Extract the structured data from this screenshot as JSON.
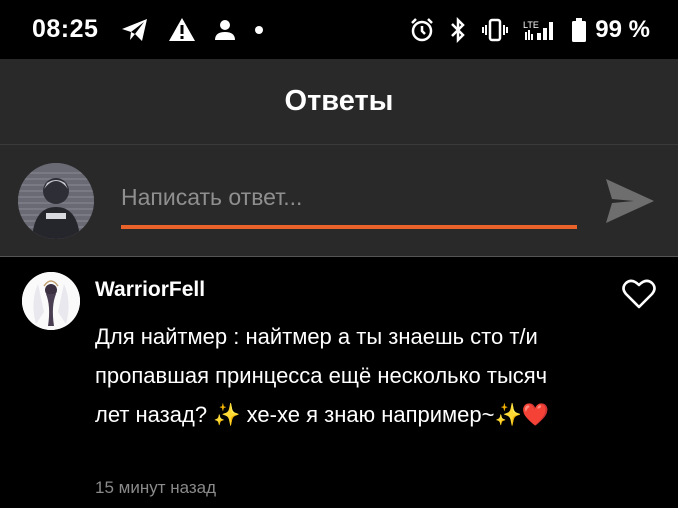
{
  "status_bar": {
    "time": "08:25",
    "left_icons": [
      "telegram-icon",
      "warning-icon",
      "person-icon",
      "dot-icon"
    ],
    "right_icons": [
      "alarm-icon",
      "bluetooth-icon",
      "vibrate-icon",
      "lte-signal-icon",
      "battery-icon"
    ],
    "lte_label": "LTE",
    "battery_text": "99 %"
  },
  "header": {
    "title": "Ответы"
  },
  "composer": {
    "placeholder": "Написать ответ...",
    "accent_color": "#e8622a",
    "send_icon": "send-icon"
  },
  "comment": {
    "author": "WarriorFell",
    "text": "Для найтмер : найтмер а ты знаешь сто т/и пропавшая принцесса ещё несколько тысяч лет назад? ✨ хе-хе я знаю например~✨❤️",
    "timestamp": "15 минут назад",
    "like_icon": "heart-outline-icon"
  }
}
